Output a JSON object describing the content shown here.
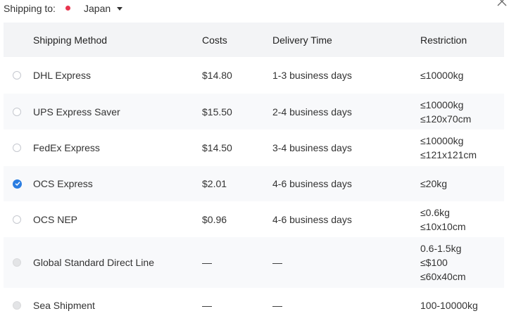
{
  "shipping": {
    "label": "Shipping to:",
    "country": "Japan",
    "colors": {
      "flag": "#e8344e",
      "accent": "#2a7de1"
    }
  },
  "table": {
    "headers": {
      "method": "Shipping Method",
      "cost": "Costs",
      "time": "Delivery Time",
      "restriction": "Restriction"
    },
    "rows": [
      {
        "method": "DHL Express",
        "cost": "$14.80",
        "time": "1-3 business days",
        "restriction": [
          "≤10000kg"
        ],
        "state": "unchecked"
      },
      {
        "method": "UPS Express Saver",
        "cost": "$15.50",
        "time": "2-4 business days",
        "restriction": [
          "≤10000kg",
          "≤120x70cm"
        ],
        "state": "unchecked"
      },
      {
        "method": "FedEx Express",
        "cost": "$14.50",
        "time": "3-4 business days",
        "restriction": [
          "≤10000kg",
          "≤121x121cm"
        ],
        "state": "unchecked"
      },
      {
        "method": "OCS Express",
        "cost": "$2.01",
        "time": "4-6 business days",
        "restriction": [
          "≤20kg"
        ],
        "state": "checked"
      },
      {
        "method": "OCS NEP",
        "cost": "$0.96",
        "time": "4-6 business days",
        "restriction": [
          "≤0.6kg",
          "≤10x10cm"
        ],
        "state": "unchecked"
      },
      {
        "method": "Global Standard Direct Line",
        "cost": "—",
        "time": "—",
        "restriction": [
          "0.6-1.5kg",
          "≤$100",
          "≤60x40cm"
        ],
        "state": "disabled"
      },
      {
        "method": "Sea Shipment",
        "cost": "—",
        "time": "—",
        "restriction": [
          "100-10000kg"
        ],
        "state": "disabled"
      }
    ]
  }
}
